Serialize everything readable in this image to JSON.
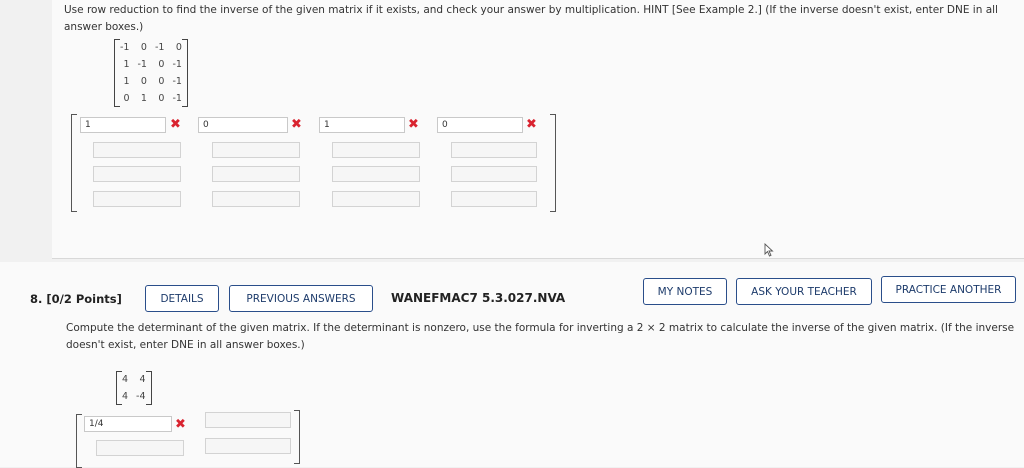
{
  "q7": {
    "prompt": "Use row reduction to find the inverse of the given matrix if it exists, and check your answer by multiplication. HINT [See Example 2.] (If the inverse doesn't exist, enter DNE in all answer boxes.)",
    "matrix": [
      [
        "-1",
        "0",
        "-1",
        "0"
      ],
      [
        "1",
        "-1",
        "0",
        "-1"
      ],
      [
        "1",
        "0",
        "0",
        "-1"
      ],
      [
        "0",
        "1",
        "0",
        "-1"
      ]
    ],
    "answers": [
      "1",
      "0",
      "1",
      "0"
    ]
  },
  "q8": {
    "number": "8.",
    "points": "[0/2 Points]",
    "details_label": "DETAILS",
    "previous_answers_label": "PREVIOUS ANSWERS",
    "code": "WANEFMAC7 5.3.027.NVA",
    "my_notes_label": "MY NOTES",
    "ask_teacher_label": "ASK YOUR TEACHER",
    "practice_another_label": "PRACTICE ANOTHER",
    "prompt": "Compute the determinant of the given matrix. If the determinant is nonzero, use the formula for inverting a 2 × 2 matrix to calculate the inverse of the given matrix. (If the inverse doesn't exist, enter DNE in all answer boxes.)",
    "matrix": [
      [
        "4",
        "4"
      ],
      [
        "4",
        "-4"
      ]
    ],
    "answers": [
      "1/4"
    ]
  },
  "colors": {
    "error": "#d9232f",
    "button_border": "#2a4e8a"
  },
  "icons": {
    "incorrect": "x-mark-icon",
    "cursor": "mouse-pointer-icon"
  }
}
